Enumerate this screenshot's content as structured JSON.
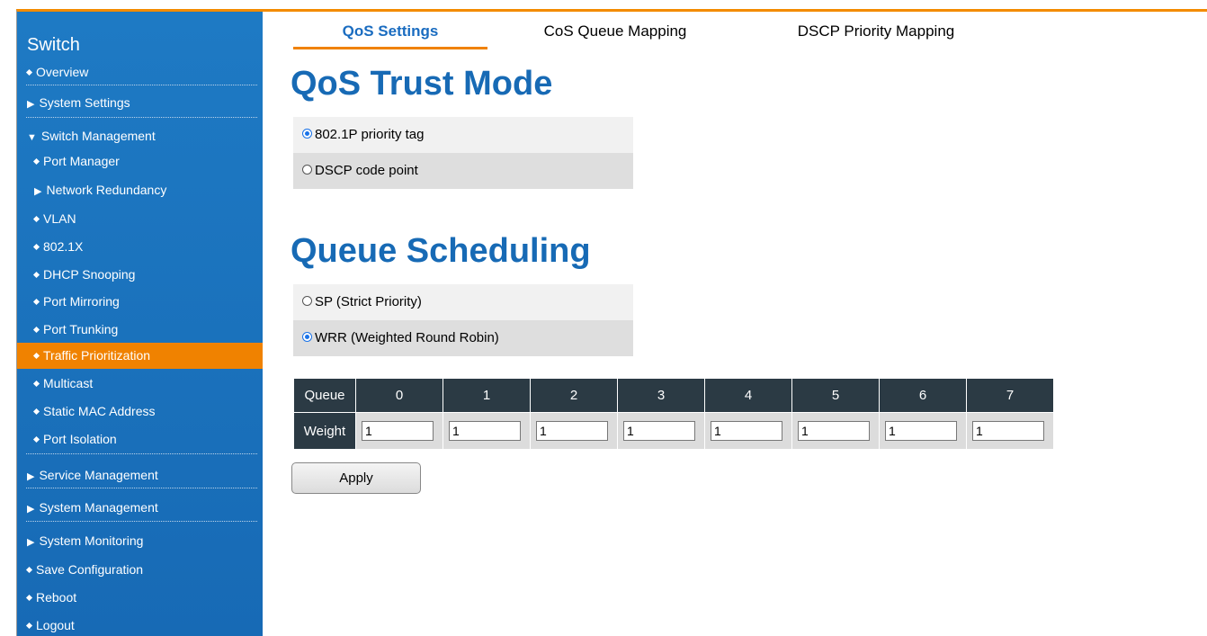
{
  "sidebar": {
    "title": "Switch",
    "items": [
      {
        "label": "Overview",
        "marker": "bullet"
      },
      {
        "label": "System Settings",
        "marker": "triangle-right"
      },
      {
        "label": "Switch Management",
        "marker": "triangle-down"
      },
      {
        "label": "Port Manager",
        "marker": "bullet"
      },
      {
        "label": "Network Redundancy",
        "marker": "triangle-right"
      },
      {
        "label": "VLAN",
        "marker": "bullet"
      },
      {
        "label": "802.1X",
        "marker": "bullet"
      },
      {
        "label": "DHCP Snooping",
        "marker": "bullet"
      },
      {
        "label": "Port Mirroring",
        "marker": "bullet"
      },
      {
        "label": "Port Trunking",
        "marker": "bullet"
      },
      {
        "label": "Traffic Prioritization",
        "marker": "bullet",
        "active": true
      },
      {
        "label": "Multicast",
        "marker": "bullet"
      },
      {
        "label": "Static MAC Address",
        "marker": "bullet"
      },
      {
        "label": "Port Isolation",
        "marker": "bullet"
      },
      {
        "label": "Service Management",
        "marker": "triangle-right"
      },
      {
        "label": "System Management",
        "marker": "triangle-right"
      },
      {
        "label": "System Monitoring",
        "marker": "triangle-right"
      },
      {
        "label": "Save Configuration",
        "marker": "bullet"
      },
      {
        "label": "Reboot",
        "marker": "bullet"
      },
      {
        "label": "Logout",
        "marker": "bullet"
      }
    ]
  },
  "tabs": [
    {
      "label": "QoS Settings",
      "active": true
    },
    {
      "label": "CoS Queue Mapping"
    },
    {
      "label": "DSCP Priority Mapping"
    }
  ],
  "trust": {
    "heading": "QoS Trust Mode",
    "options": [
      {
        "label": "802.1P priority tag",
        "selected": true
      },
      {
        "label": "DSCP code point",
        "selected": false
      }
    ]
  },
  "scheduling": {
    "heading": "Queue Scheduling",
    "options": [
      {
        "label": "SP (Strict Priority)",
        "selected": false
      },
      {
        "label": "WRR (Weighted Round Robin)",
        "selected": true
      }
    ]
  },
  "queue_table": {
    "queue_label": "Queue",
    "weight_label": "Weight",
    "queues": [
      "0",
      "1",
      "2",
      "3",
      "4",
      "5",
      "6",
      "7"
    ],
    "weights": [
      "1",
      "1",
      "1",
      "1",
      "1",
      "1",
      "1",
      "1"
    ]
  },
  "apply_label": "Apply",
  "colors": {
    "accent": "#f08200",
    "sidebar": "#1e7ac4",
    "heading": "#176ab5",
    "table_header": "#2b3a44"
  }
}
